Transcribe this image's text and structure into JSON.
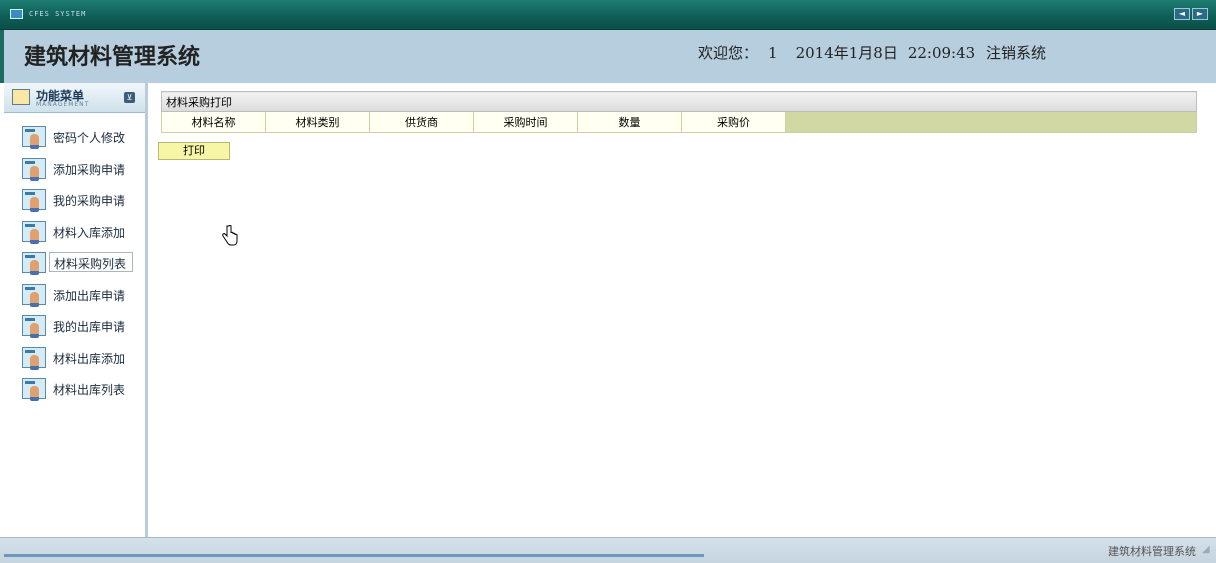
{
  "window": {
    "system_name": "CFES SYSTEM",
    "arrows": [
      "◄",
      "►"
    ]
  },
  "header": {
    "title": "建筑材料管理系统",
    "welcome_label": "欢迎您：",
    "user": "1",
    "date": "2014年1月8日",
    "time": "22:09:43",
    "logout": "注销系统"
  },
  "sidebar": {
    "menu_title": "功能菜单",
    "menu_subtitle": "MANAGEMENT",
    "toggle": "⊻",
    "items": [
      {
        "label": "密码个人修改"
      },
      {
        "label": "添加采购申请"
      },
      {
        "label": "我的采购申请"
      },
      {
        "label": "材料入库添加"
      },
      {
        "label": "材料采购列表"
      },
      {
        "label": "添加出库申请"
      },
      {
        "label": "我的出库申请"
      },
      {
        "label": "材料出库添加"
      },
      {
        "label": "材料出库列表"
      }
    ],
    "active_index": 4
  },
  "main": {
    "table_caption": "材料采购打印",
    "columns": [
      "材料名称",
      "材料类别",
      "供货商",
      "采购时间",
      "数量",
      "采购价"
    ],
    "print_button": "打印"
  },
  "statusbar": {
    "text": "建筑材料管理系统"
  },
  "colors": {
    "header_bg": "#b6cedd",
    "topbar": "#0f5f57",
    "column_fill": "#d1d8a4",
    "button_bg": "#f6f6a6"
  }
}
